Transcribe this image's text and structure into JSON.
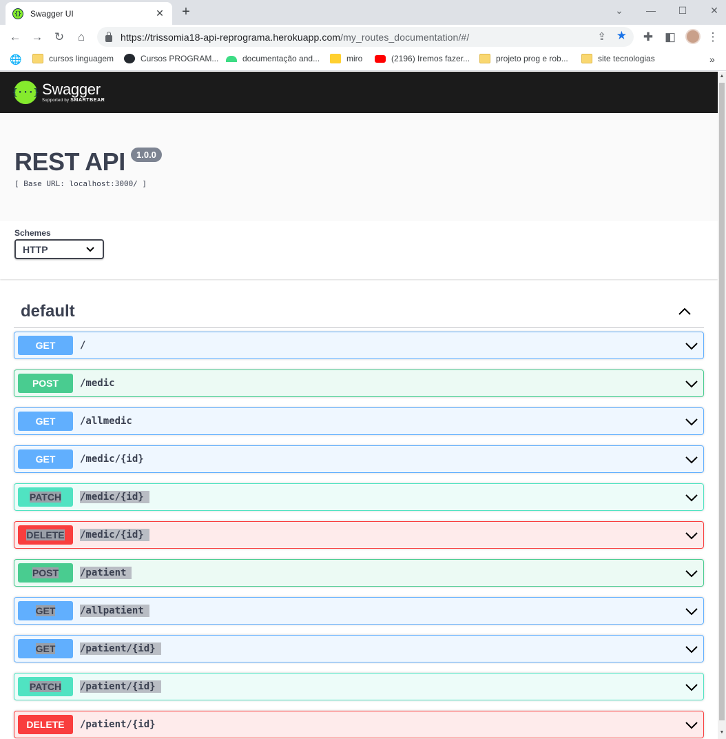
{
  "browser": {
    "tab_title": "Swagger UI",
    "url_host": "https://trissomia18-api-reprograma.herokuapp.com",
    "url_path": "/my_routes_documentation/#/",
    "bookmarks": [
      {
        "label": "cursos linguagem",
        "icon": "folder-icon"
      },
      {
        "label": "Cursos  PROGRAM...",
        "icon": "github-icon"
      },
      {
        "label": "documentação and...",
        "icon": "android-icon"
      },
      {
        "label": "miro",
        "icon": "miro-icon"
      },
      {
        "label": "(2196) Iremos fazer...",
        "icon": "youtube-icon"
      },
      {
        "label": "projeto prog e rob...",
        "icon": "folder-icon"
      },
      {
        "label": "site tecnologias",
        "icon": "folder-icon"
      }
    ],
    "more_bookmarks": "»"
  },
  "swagger": {
    "logo_name": "Swagger",
    "logo_sub_prefix": "Supported by",
    "logo_sub_brand": "SMARTBEAR",
    "title": "REST API",
    "version": "1.0.0",
    "base_url": "[ Base URL: localhost:3000/ ]",
    "schemes_label": "Schemes",
    "scheme_selected": "HTTP",
    "tag": "default",
    "operations": [
      {
        "method": "GET",
        "path": "/",
        "kind": "get",
        "selected": false
      },
      {
        "method": "POST",
        "path": "/medic",
        "kind": "post",
        "selected": false
      },
      {
        "method": "GET",
        "path": "/allmedic",
        "kind": "get",
        "selected": false
      },
      {
        "method": "GET",
        "path": "/medic/{id}",
        "kind": "get",
        "selected": false
      },
      {
        "method": "PATCH",
        "path": "/medic/{id}",
        "kind": "patch",
        "selected": true
      },
      {
        "method": "DELETE",
        "path": "/medic/{id}",
        "kind": "delete",
        "selected": true
      },
      {
        "method": "POST",
        "path": "/patient",
        "kind": "post",
        "selected": true
      },
      {
        "method": "GET",
        "path": "/allpatient",
        "kind": "get",
        "selected": true
      },
      {
        "method": "GET",
        "path": "/patient/{id}",
        "kind": "get",
        "selected": true
      },
      {
        "method": "PATCH",
        "path": "/patient/{id}",
        "kind": "patch",
        "selected": true
      },
      {
        "method": "DELETE",
        "path": "/patient/{id}",
        "kind": "delete",
        "selected": false
      }
    ]
  },
  "colors": {
    "get": "#61affe",
    "post": "#49cc90",
    "patch": "#50e3c2",
    "delete": "#f93e3e",
    "topbar": "#1b1b1b",
    "logo": "#85ea2d"
  }
}
